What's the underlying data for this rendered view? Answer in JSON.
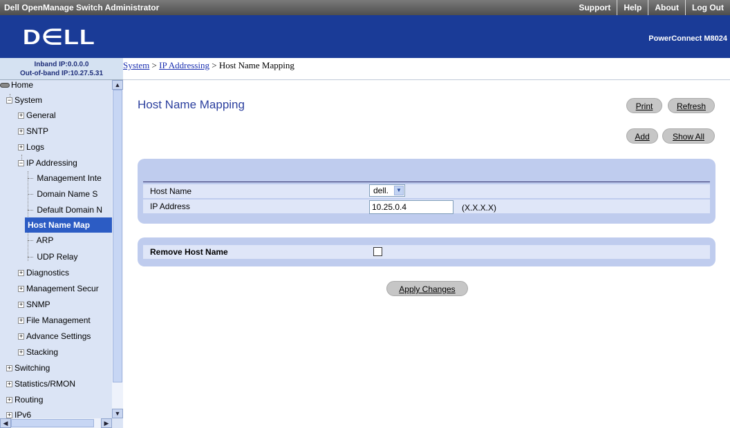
{
  "app": {
    "title": "Dell OpenManage Switch Administrator",
    "nav": [
      "Support",
      "Help",
      "About",
      "Log Out"
    ],
    "logo": "D∈LL",
    "product": "PowerConnect M8024"
  },
  "ip_info": {
    "inband": "Inband IP:0.0.0.0",
    "outofband": "Out-of-band IP:10.27.5.31"
  },
  "sidebar": {
    "items": [
      {
        "label": "Home"
      },
      {
        "label": "System"
      },
      {
        "label": "General"
      },
      {
        "label": "SNTP"
      },
      {
        "label": "Logs"
      },
      {
        "label": "IP Addressing"
      },
      {
        "label": "Management Inte"
      },
      {
        "label": "Domain Name S"
      },
      {
        "label": "Default Domain N"
      },
      {
        "label": "Host Name Map"
      },
      {
        "label": "ARP"
      },
      {
        "label": "UDP Relay"
      },
      {
        "label": "Diagnostics"
      },
      {
        "label": "Management Secur"
      },
      {
        "label": "SNMP"
      },
      {
        "label": "File Management"
      },
      {
        "label": "Advance Settings"
      },
      {
        "label": "Stacking"
      },
      {
        "label": "Switching"
      },
      {
        "label": "Statistics/RMON"
      },
      {
        "label": "Routing"
      },
      {
        "label": "IPv6"
      }
    ],
    "selected": "Host Name Map"
  },
  "breadcrumb": {
    "system": "System",
    "sep": ">",
    "ip_addressing": "IP Addressing",
    "current": "Host Name Mapping"
  },
  "page": {
    "title": "Host Name Mapping",
    "buttons": {
      "print": "Print",
      "refresh": "Refresh",
      "add": "Add",
      "show_all": "Show All",
      "apply": "Apply Changes"
    }
  },
  "form": {
    "host_name_label": "Host Name",
    "host_name_value": "dell.",
    "ip_label": "IP Address",
    "ip_value": "10.25.0.4",
    "ip_hint": "(X.X.X.X)",
    "remove_label": "Remove Host Name",
    "remove_checked": false
  }
}
